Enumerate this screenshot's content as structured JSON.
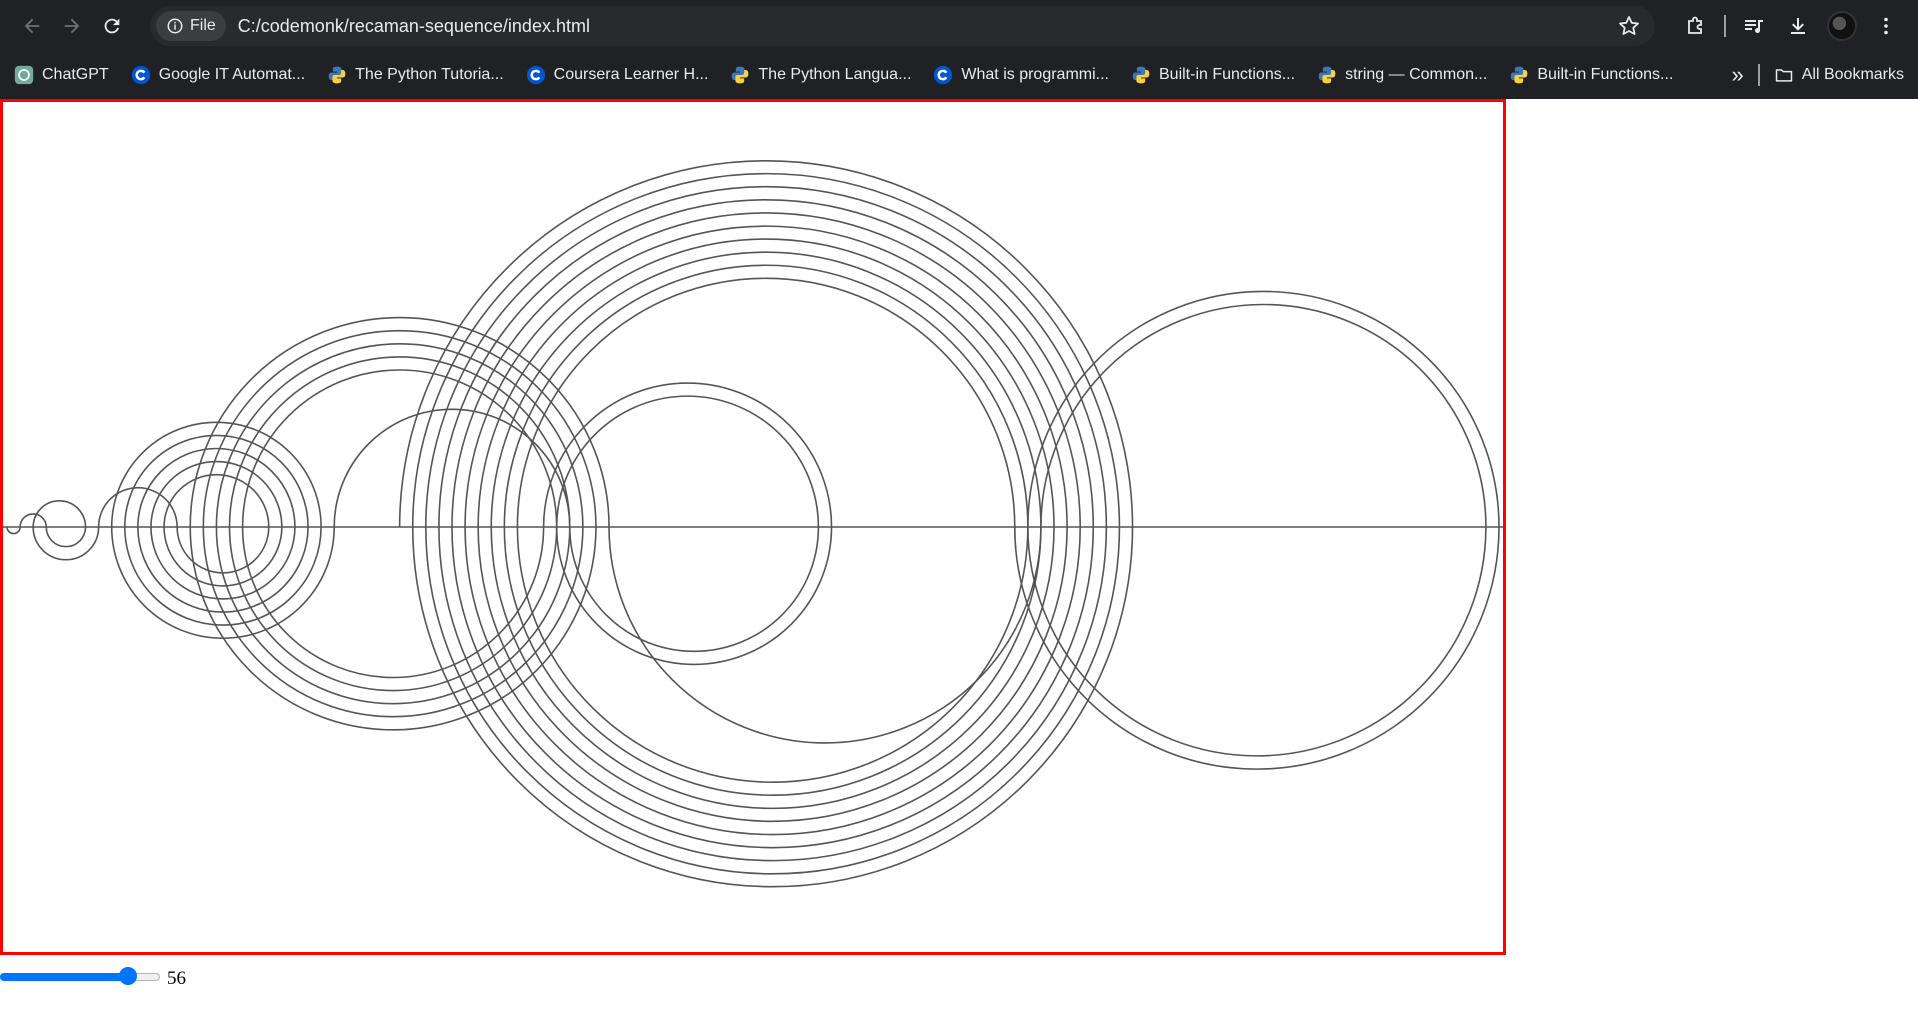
{
  "browser": {
    "address_chip": "File",
    "url": "C:/codemonk/recaman-sequence/index.html",
    "bookmarks": [
      {
        "label": "ChatGPT",
        "icon": "chatgpt-icon"
      },
      {
        "label": "Google IT Automat...",
        "icon": "coursera-icon"
      },
      {
        "label": "The Python Tutoria...",
        "icon": "python-icon"
      },
      {
        "label": "Coursera Learner H...",
        "icon": "coursera-icon"
      },
      {
        "label": "The Python Langua...",
        "icon": "python-icon"
      },
      {
        "label": "What is programmi...",
        "icon": "coursera-icon"
      },
      {
        "label": "Built-in Functions...",
        "icon": "python-icon"
      },
      {
        "label": "string — Common...",
        "icon": "python-icon"
      },
      {
        "label": "Built-in Functions...",
        "icon": "python-icon"
      }
    ],
    "all_bookmarks": "All Bookmarks"
  },
  "page": {
    "slider": {
      "min": 0,
      "max": 70,
      "value": 56
    },
    "value_label": "56"
  },
  "colors": {
    "canvas_border": "#ff0000",
    "stroke": "#555555",
    "slider_accent": "#0075ff"
  }
}
